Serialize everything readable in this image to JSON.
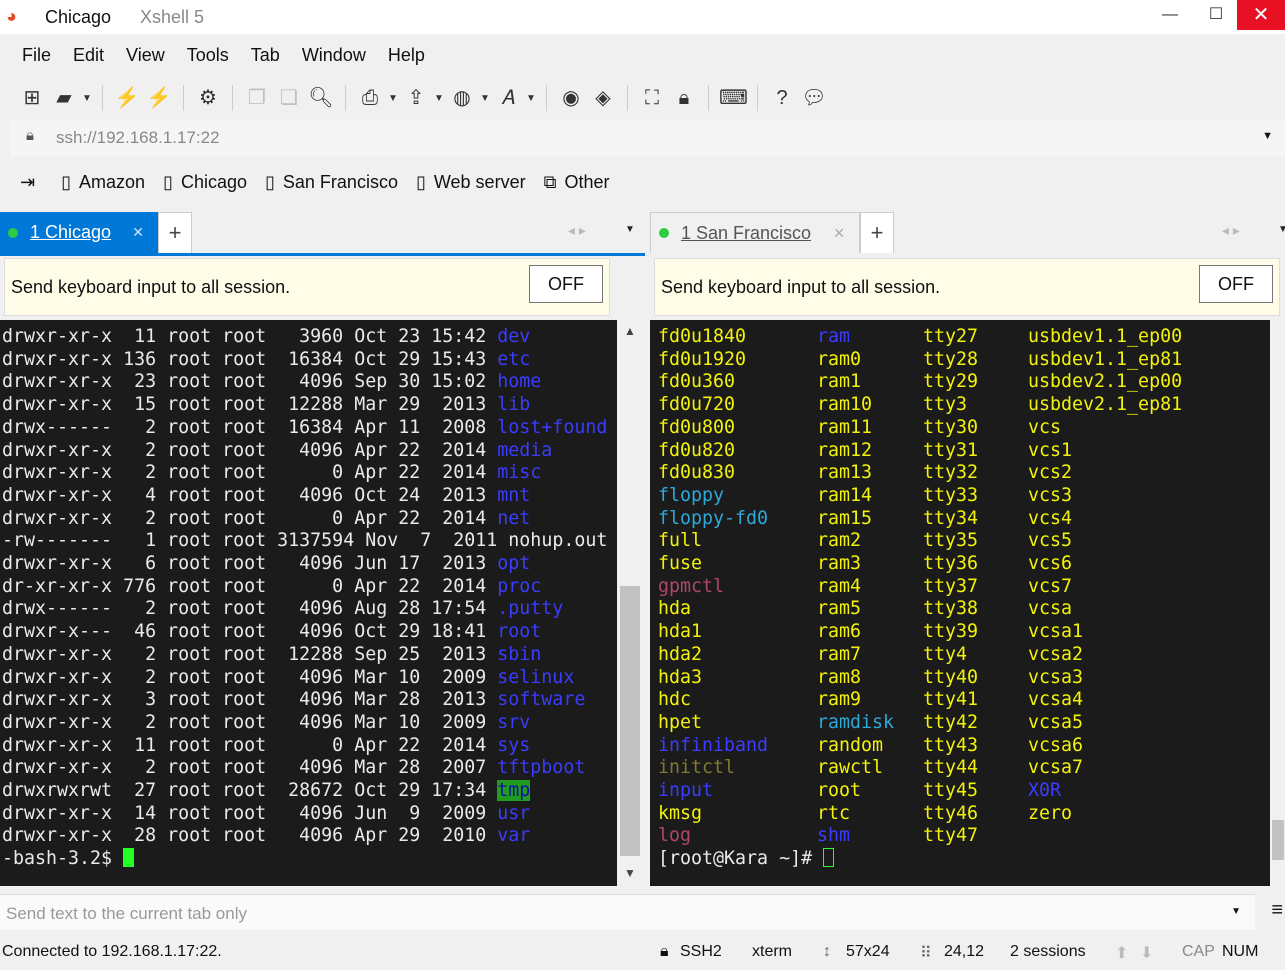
{
  "window": {
    "title": "Chicago",
    "app": "Xshell 5",
    "min": "—",
    "max": "☐",
    "close": "✕"
  },
  "menu": [
    "File",
    "Edit",
    "View",
    "Tools",
    "Tab",
    "Window",
    "Help"
  ],
  "address": {
    "url": "ssh://192.168.1.17:22"
  },
  "links": [
    {
      "label": "Amazon"
    },
    {
      "label": "Chicago"
    },
    {
      "label": "San Francisco"
    },
    {
      "label": "Web server"
    },
    {
      "label": "Other"
    }
  ],
  "left": {
    "tab_label": "1 Chicago",
    "broadcast": "Send keyboard input to all session.",
    "off": "OFF",
    "lines": [
      [
        "drwxr-xr-x  11 root root   3960 Oct 23 15:42 ",
        "dev",
        "b"
      ],
      [
        "drwxr-xr-x 136 root root  16384 Oct 29 15:43 ",
        "etc",
        "b"
      ],
      [
        "drwxr-xr-x  23 root root   4096 Sep 30 15:02 ",
        "home",
        "b"
      ],
      [
        "drwxr-xr-x  15 root root  12288 Mar 29  2013 ",
        "lib",
        "b"
      ],
      [
        "drwx------   2 root root  16384 Apr 11  2008 ",
        "lost+found",
        "b"
      ],
      [
        "drwxr-xr-x   2 root root   4096 Apr 22  2014 ",
        "media",
        "b"
      ],
      [
        "drwxr-xr-x   2 root root      0 Apr 22  2014 ",
        "misc",
        "b"
      ],
      [
        "drwxr-xr-x   4 root root   4096 Oct 24  2013 ",
        "mnt",
        "b"
      ],
      [
        "drwxr-xr-x   2 root root      0 Apr 22  2014 ",
        "net",
        "b"
      ],
      [
        "-rw-------   1 root root 3137594 Nov  7  2011 ",
        "nohup.out",
        ""
      ],
      [
        "drwxr-xr-x   6 root root   4096 Jun 17  2013 ",
        "opt",
        "b"
      ],
      [
        "dr-xr-xr-x 776 root root      0 Apr 22  2014 ",
        "proc",
        "b"
      ],
      [
        "drwx------   2 root root   4096 Aug 28 17:54 ",
        ".putty",
        "b"
      ],
      [
        "drwxr-x---  46 root root   4096 Oct 29 18:41 ",
        "root",
        "b"
      ],
      [
        "drwxr-xr-x   2 root root  12288 Sep 25  2013 ",
        "sbin",
        "b"
      ],
      [
        "drwxr-xr-x   2 root root   4096 Mar 10  2009 ",
        "selinux",
        "b"
      ],
      [
        "drwxr-xr-x   3 root root   4096 Mar 28  2013 ",
        "software",
        "b"
      ],
      [
        "drwxr-xr-x   2 root root   4096 Mar 10  2009 ",
        "srv",
        "b"
      ],
      [
        "drwxr-xr-x  11 root root      0 Apr 22  2014 ",
        "sys",
        "b"
      ],
      [
        "drwxr-xr-x   2 root root   4096 Mar 28  2007 ",
        "tftpboot",
        "b"
      ],
      [
        "drwxrwxrwt  27 root root  28672 Oct 29 17:34 ",
        "tmp",
        "tmp"
      ],
      [
        "drwxr-xr-x  14 root root   4096 Jun  9  2009 ",
        "usr",
        "b"
      ],
      [
        "drwxr-xr-x  28 root root   4096 Apr 29  2010 ",
        "var",
        "b"
      ]
    ],
    "prompt": "-bash-3.2$ "
  },
  "right": {
    "tab_label": "1 San Francisco",
    "broadcast": "Send keyboard input to all session.",
    "off": "OFF",
    "rows": [
      [
        [
          "fd0u1840",
          "g"
        ],
        [
          "ram",
          "b"
        ],
        [
          "tty27",
          "g"
        ],
        [
          "usbdev1.1_ep00",
          "g"
        ]
      ],
      [
        [
          "fd0u1920",
          "g"
        ],
        [
          "ram0",
          "g"
        ],
        [
          "tty28",
          "g"
        ],
        [
          "usbdev1.1_ep81",
          "g"
        ]
      ],
      [
        [
          "fd0u360",
          "g"
        ],
        [
          "ram1",
          "g"
        ],
        [
          "tty29",
          "g"
        ],
        [
          "usbdev2.1_ep00",
          "g"
        ]
      ],
      [
        [
          "fd0u720",
          "g"
        ],
        [
          "ram10",
          "g"
        ],
        [
          "tty3",
          "g"
        ],
        [
          "usbdev2.1_ep81",
          "g"
        ]
      ],
      [
        [
          "fd0u800",
          "g"
        ],
        [
          "ram11",
          "g"
        ],
        [
          "tty30",
          "g"
        ],
        [
          "vcs",
          "g"
        ]
      ],
      [
        [
          "fd0u820",
          "g"
        ],
        [
          "ram12",
          "g"
        ],
        [
          "tty31",
          "g"
        ],
        [
          "vcs1",
          "g"
        ]
      ],
      [
        [
          "fd0u830",
          "g"
        ],
        [
          "ram13",
          "g"
        ],
        [
          "tty32",
          "g"
        ],
        [
          "vcs2",
          "g"
        ]
      ],
      [
        [
          "floppy",
          "c"
        ],
        [
          "ram14",
          "g"
        ],
        [
          "tty33",
          "g"
        ],
        [
          "vcs3",
          "g"
        ]
      ],
      [
        [
          "floppy-fd0",
          "c"
        ],
        [
          "ram15",
          "g"
        ],
        [
          "tty34",
          "g"
        ],
        [
          "vcs4",
          "g"
        ]
      ],
      [
        [
          "full",
          "g"
        ],
        [
          "ram2",
          "g"
        ],
        [
          "tty35",
          "g"
        ],
        [
          "vcs5",
          "g"
        ]
      ],
      [
        [
          "fuse",
          "g"
        ],
        [
          "ram3",
          "g"
        ],
        [
          "tty36",
          "g"
        ],
        [
          "vcs6",
          "g"
        ]
      ],
      [
        [
          "gpmctl",
          "mag"
        ],
        [
          "ram4",
          "g"
        ],
        [
          "tty37",
          "g"
        ],
        [
          "vcs7",
          "g"
        ]
      ],
      [
        [
          "hda",
          "g"
        ],
        [
          "ram5",
          "g"
        ],
        [
          "tty38",
          "g"
        ],
        [
          "vcsa",
          "g"
        ]
      ],
      [
        [
          "hda1",
          "g"
        ],
        [
          "ram6",
          "g"
        ],
        [
          "tty39",
          "g"
        ],
        [
          "vcsa1",
          "g"
        ]
      ],
      [
        [
          "hda2",
          "g"
        ],
        [
          "ram7",
          "g"
        ],
        [
          "tty4",
          "g"
        ],
        [
          "vcsa2",
          "g"
        ]
      ],
      [
        [
          "hda3",
          "g"
        ],
        [
          "ram8",
          "g"
        ],
        [
          "tty40",
          "g"
        ],
        [
          "vcsa3",
          "g"
        ]
      ],
      [
        [
          "hdc",
          "g"
        ],
        [
          "ram9",
          "g"
        ],
        [
          "tty41",
          "g"
        ],
        [
          "vcsa4",
          "g"
        ]
      ],
      [
        [
          "hpet",
          "g"
        ],
        [
          "ramdisk",
          "c"
        ],
        [
          "tty42",
          "g"
        ],
        [
          "vcsa5",
          "g"
        ]
      ],
      [
        [
          "infiniband",
          "b"
        ],
        [
          "random",
          "g"
        ],
        [
          "tty43",
          "g"
        ],
        [
          "vcsa6",
          "g"
        ]
      ],
      [
        [
          "initctl",
          "ol"
        ],
        [
          "rawctl",
          "g"
        ],
        [
          "tty44",
          "g"
        ],
        [
          "vcsa7",
          "g"
        ]
      ],
      [
        [
          "input",
          "b"
        ],
        [
          "root",
          "g"
        ],
        [
          "tty45",
          "g"
        ],
        [
          "X0R",
          "b"
        ]
      ],
      [
        [
          "kmsg",
          "g"
        ],
        [
          "rtc",
          "g"
        ],
        [
          "tty46",
          "g"
        ],
        [
          "zero",
          "g"
        ]
      ],
      [
        [
          "log",
          "mag"
        ],
        [
          "shm",
          "b"
        ],
        [
          "tty47",
          "g"
        ],
        [
          "",
          ""
        ]
      ]
    ],
    "prompt": "[root@Kara ~]# "
  },
  "sendbar": {
    "placeholder": "Send text to the current tab only"
  },
  "status": {
    "connected": "Connected to 192.168.1.17:22.",
    "proto": "SSH2",
    "term": "xterm",
    "size": "57x24",
    "pos": "24,12",
    "sessions": "2 sessions",
    "cap": "CAP",
    "num": "NUM"
  },
  "colors": {
    "accent": "#0078d7",
    "close": "#e81123",
    "term_bg": "#1b1b1b",
    "cursor": "#22ff22"
  }
}
